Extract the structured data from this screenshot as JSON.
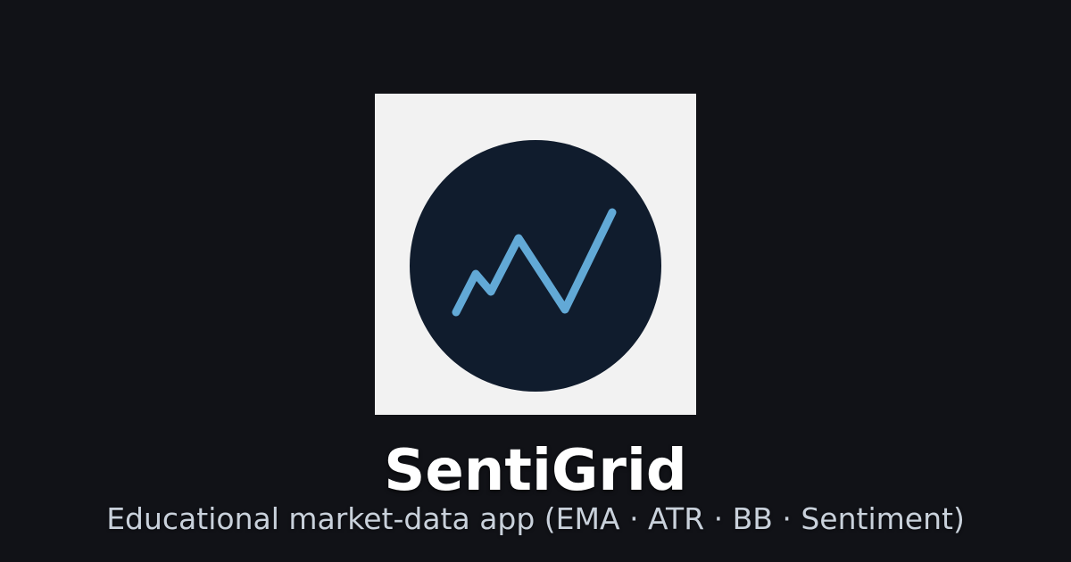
{
  "app": {
    "title": "SentiGrid",
    "subtitle": "Educational market-data app (EMA · ATR · BB · Sentiment)"
  },
  "logo": {
    "icon": "trend-line-chart-icon",
    "tile_color": "#f2f2f2",
    "circle_color": "#101c2d",
    "line_color": "#62a9d6"
  },
  "colors": {
    "background": "#111217",
    "title": "#ffffff",
    "subtitle": "#c9d1db"
  }
}
